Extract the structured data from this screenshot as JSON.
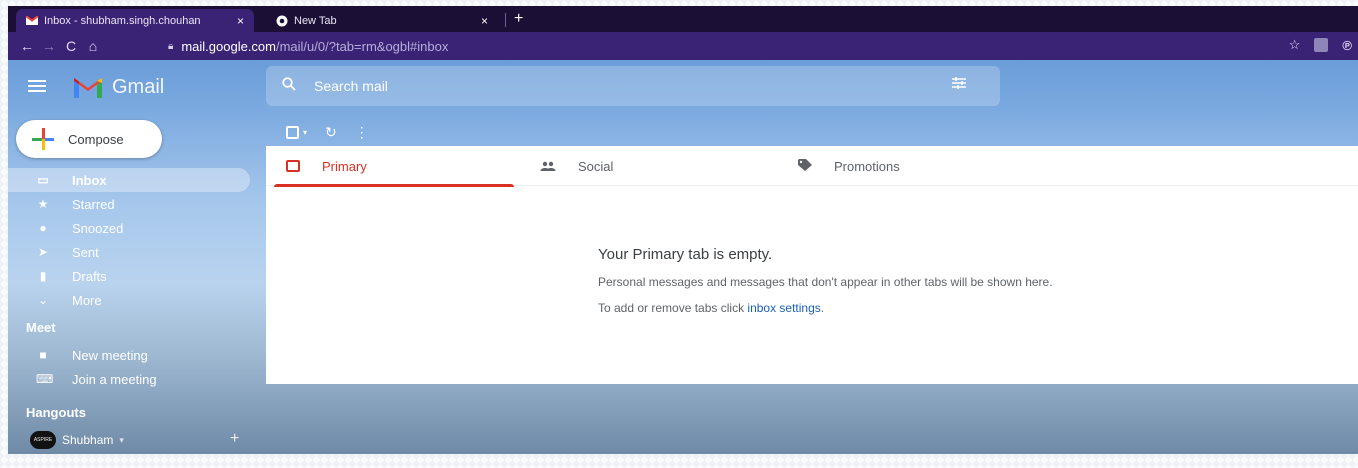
{
  "browser": {
    "tabs": [
      {
        "title": "Inbox - shubham.singh.chouhan",
        "active": true,
        "favicon": "gmail-icon"
      },
      {
        "title": "New Tab",
        "active": false,
        "favicon": "chrome-icon"
      }
    ],
    "new_tab_label": "+",
    "close_label": "×",
    "url_host": "mail.google.com",
    "url_path": "/mail/u/0/?tab=rm&ogbl#inbox",
    "icons": [
      "back-icon",
      "forward-icon",
      "reload-icon",
      "home-icon",
      "lock-icon",
      "star-icon",
      "extension-icon",
      "pinterest-icon"
    ]
  },
  "gmail": {
    "logo_text": "Gmail",
    "search_placeholder": "Search mail",
    "compose_label": "Compose",
    "nav": [
      {
        "label": "Inbox",
        "icon": "inbox-icon",
        "active": true
      },
      {
        "label": "Starred",
        "icon": "star-icon"
      },
      {
        "label": "Snoozed",
        "icon": "clock-icon"
      },
      {
        "label": "Sent",
        "icon": "send-icon"
      },
      {
        "label": "Drafts",
        "icon": "draft-icon"
      },
      {
        "label": "More",
        "icon": "chevron-down-icon"
      }
    ],
    "meet": {
      "title": "Meet",
      "items": [
        {
          "label": "New meeting",
          "icon": "video-icon"
        },
        {
          "label": "Join a meeting",
          "icon": "keyboard-icon"
        }
      ]
    },
    "hangouts": {
      "title": "Hangouts",
      "user": "Shubham",
      "avatar_text": "ASPIRE",
      "add_label": "+"
    },
    "tabs": [
      {
        "label": "Primary",
        "icon": "inbox-icon",
        "active": true
      },
      {
        "label": "Social",
        "icon": "people-icon"
      },
      {
        "label": "Promotions",
        "icon": "tag-icon"
      }
    ],
    "empty_state": {
      "title": "Your Primary tab is empty.",
      "line1": "Personal messages and messages that don't appear in other tabs will be shown here.",
      "line2_prefix": "To add or remove tabs click",
      "line2_link": "inbox settings",
      "line2_suffix": "."
    }
  },
  "colors": {
    "primary_red": "#d93025",
    "browser_dark": "#1c0f36",
    "browser_toolbar": "#3a2275",
    "link_blue": "#1a5fb4"
  }
}
